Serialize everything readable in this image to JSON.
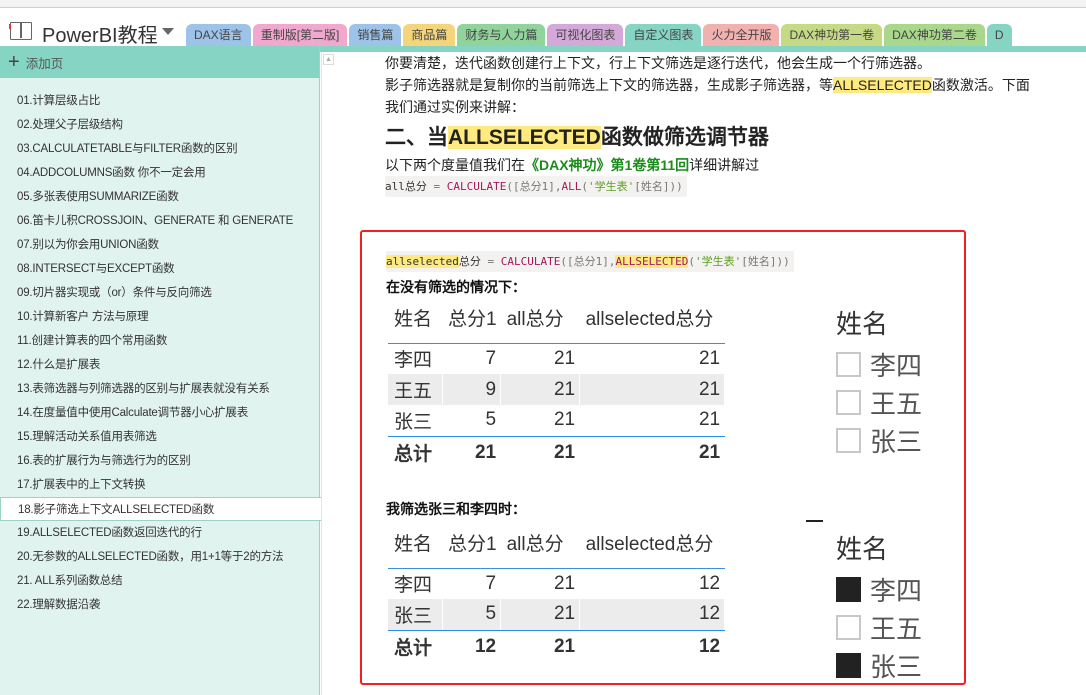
{
  "notebook": {
    "title": "PowerBI教程",
    "icon": "notebook-icon"
  },
  "tabs": [
    {
      "label": "DAX语言",
      "color": "#9dc3e8"
    },
    {
      "label": "重制版[第二版]",
      "color": "#f0a8cf"
    },
    {
      "label": "销售篇",
      "color": "#9dc3e8"
    },
    {
      "label": "商品篇",
      "color": "#f4d57c"
    },
    {
      "label": "财务与人力篇",
      "color": "#90d49c"
    },
    {
      "label": "可视化图表",
      "color": "#d4a8d8"
    },
    {
      "label": "自定义图表",
      "color": "#86d4c4"
    },
    {
      "label": "火力全开版",
      "color": "#f1b1ae"
    },
    {
      "label": "DAX神功第一卷",
      "color": "#c6da85"
    },
    {
      "label": "DAX神功第二卷",
      "color": "#a9d78c"
    },
    {
      "label": "D",
      "color": "#86d4c4"
    }
  ],
  "sidebar": {
    "add_page": "添加页",
    "pages": [
      "01.计算层级占比",
      "02.处理父子层级结构",
      "03.CALCULATETABLE与FILTER函数的区别",
      "04.ADDCOLUMNS函数 你不一定会用",
      "05.多张表使用SUMMARIZE函数",
      "06.笛卡儿积CROSSJOIN、GENERATE 和 GENERATE",
      "07.别以为你会用UNION函数",
      "08.INTERSECT与EXCEPT函数",
      "09.切片器实现或（or）条件与反向筛选",
      "10.计算新客户 方法与原理",
      "11.创建计算表的四个常用函数",
      "12.什么是扩展表",
      "13.表筛选器与列筛选器的区别与扩展表就没有关系",
      "14.在度量值中使用Calculate调节器小心扩展表",
      "15.理解活动关系值用表筛选",
      "16.表的扩展行为与筛选行为的区别",
      "17.扩展表中的上下文转换",
      "18.影子筛选上下文ALLSELECTED函数",
      "19.ALLSELECTED函数返回迭代的行",
      "20.无参数的ALLSELECTED函数，用1+1等于2的方法",
      "21. ALL系列函数总结",
      "22.理解数据沿袭"
    ],
    "selected_index": 17
  },
  "content": {
    "p1": "你要清楚，迭代函数创建行上下文，行上下文筛选是逐行迭代，他会生成一个行筛选器。",
    "p2a": "影子筛选器就是复制你的当前筛选上下文的筛选器，生成影子筛选器，等",
    "p2hl": "ALLSELECTED",
    "p2b": "函数激活。下面",
    "p3": "我们通过实例来讲解：",
    "h2a": "二、当",
    "h2hl": "ALLSELECTED",
    "h2b": "函数做筛选调节器",
    "p4a": "以下两个度量值我们在",
    "p4g": "《DAX神功》第1卷第11回",
    "p4b": "详细讲解过",
    "code1": {
      "name": "all总分",
      "eq": " = ",
      "fn": "CALCULATE",
      "a": "([总分1],",
      "fn2": "ALL",
      "b": "(",
      "str": "'学生表'",
      "c": "[姓名])",
      "d": ")"
    },
    "code2": {
      "name": "allselected",
      "name2": "总分",
      "eq": " = ",
      "fn": "CALCULATE",
      "a": "([总分1],",
      "fn2": "ALLSELECTED",
      "b": "(",
      "str": "'学生表'",
      "c": "[姓名])",
      "d": ")"
    },
    "case1": {
      "heading": "在没有筛选的情况下：",
      "columns": [
        "姓名",
        "总分1",
        "all总分",
        "allselected总分"
      ],
      "rows": [
        [
          "李四",
          "7",
          "21",
          "21"
        ],
        [
          "王五",
          "9",
          "21",
          "21"
        ],
        [
          "张三",
          "5",
          "21",
          "21"
        ]
      ],
      "total": [
        "总计",
        "21",
        "21",
        "21"
      ],
      "slicer": {
        "title": "姓名",
        "items": [
          {
            "label": "李四",
            "checked": false
          },
          {
            "label": "王五",
            "checked": false
          },
          {
            "label": "张三",
            "checked": false
          }
        ]
      }
    },
    "case2": {
      "heading": "我筛选张三和李四时：",
      "columns": [
        "姓名",
        "总分1",
        "all总分",
        "allselected总分"
      ],
      "rows": [
        [
          "李四",
          "7",
          "21",
          "12"
        ],
        [
          "张三",
          "5",
          "21",
          "12"
        ]
      ],
      "total": [
        "总计",
        "12",
        "21",
        "12"
      ],
      "slicer": {
        "title": "姓名",
        "items": [
          {
            "label": "李四",
            "checked": true
          },
          {
            "label": "王五",
            "checked": false
          },
          {
            "label": "张三",
            "checked": true
          }
        ]
      }
    }
  },
  "colors": {
    "highlight": "#ffea7f",
    "frame": "#f32020",
    "sidebar_bg": "#e1f3ef",
    "accent": "#85d4c4"
  }
}
